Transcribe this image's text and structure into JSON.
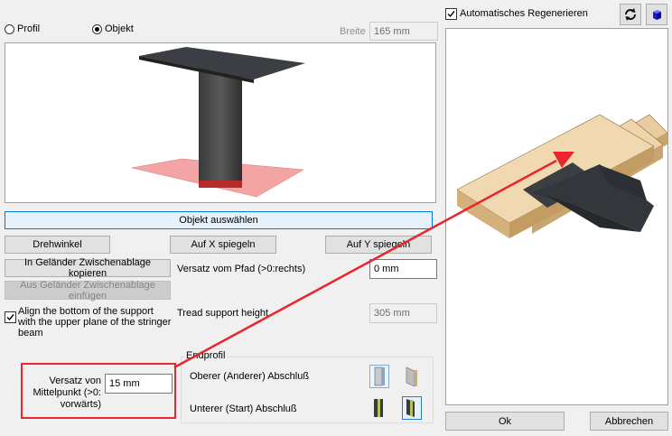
{
  "profile_mode": {
    "profil_label": "Profil",
    "objekt_label": "Objekt",
    "selected": "Objekt"
  },
  "width": {
    "label": "Breite",
    "value": "165 mm"
  },
  "buttons": {
    "select_object": "Objekt auswählen",
    "rotate_angle": "Drehwinkel",
    "mirror_x": "Auf X spiegeln",
    "mirror_y": "Auf Y spiegeln",
    "copy_clipboard": "In Geländer Zwischenablage kopieren",
    "paste_clipboard": "Aus Geländer Zwischenablage einfügen",
    "ok": "Ok",
    "cancel": "Abbrechen"
  },
  "path_offset": {
    "label": "Versatz vom Pfad (>0:rechts)",
    "value": "0 mm"
  },
  "align_bottom": {
    "label": "Align the bottom of the support with the upper plane of the stringer beam",
    "checked": true
  },
  "tread_support": {
    "label": "Tread support height",
    "value": "305 mm"
  },
  "center_offset": {
    "label": "Versatz von Mittelpunkt (>0: vorwärts)",
    "value": "15 mm"
  },
  "endprofil": {
    "title": "Endprofil",
    "upper_label": "Oberer (Anderer) Abschluß",
    "lower_label": "Unterer (Start) Abschluß"
  },
  "auto_regen": {
    "label": "Automatisches Regenerieren",
    "checked": true
  },
  "colors": {
    "highlight_red": "#e8262d",
    "accent_blue": "#0078d7",
    "wood": "#e9cda0"
  }
}
